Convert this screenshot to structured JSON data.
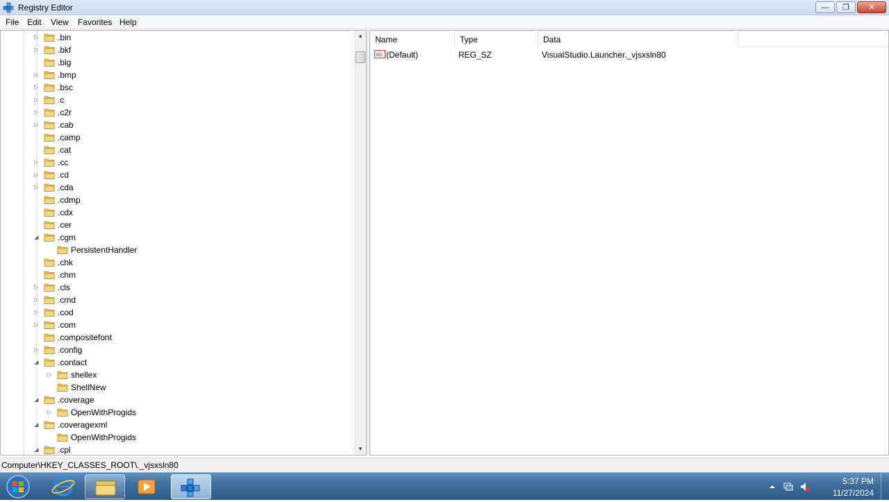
{
  "window": {
    "title": "Registry Editor",
    "minimize_glyph": "—",
    "restore_glyph": "❐",
    "close_glyph": "✕"
  },
  "menu": {
    "items": [
      "File",
      "Edit",
      "View",
      "Favorites",
      "Help"
    ]
  },
  "tree": {
    "nodes": [
      {
        "label": ".bin",
        "level": 0,
        "expander": "collapsed"
      },
      {
        "label": ".bkf",
        "level": 0,
        "expander": "collapsed"
      },
      {
        "label": ".blg",
        "level": 0,
        "expander": "none"
      },
      {
        "label": ".bmp",
        "level": 0,
        "expander": "collapsed"
      },
      {
        "label": ".bsc",
        "level": 0,
        "expander": "collapsed"
      },
      {
        "label": ".c",
        "level": 0,
        "expander": "collapsed"
      },
      {
        "label": ".c2r",
        "level": 0,
        "expander": "collapsed"
      },
      {
        "label": ".cab",
        "level": 0,
        "expander": "collapsed"
      },
      {
        "label": ".camp",
        "level": 0,
        "expander": "none"
      },
      {
        "label": ".cat",
        "level": 0,
        "expander": "none"
      },
      {
        "label": ".cc",
        "level": 0,
        "expander": "collapsed"
      },
      {
        "label": ".cd",
        "level": 0,
        "expander": "collapsed"
      },
      {
        "label": ".cda",
        "level": 0,
        "expander": "collapsed"
      },
      {
        "label": ".cdmp",
        "level": 0,
        "expander": "none"
      },
      {
        "label": ".cdx",
        "level": 0,
        "expander": "none"
      },
      {
        "label": ".cer",
        "level": 0,
        "expander": "none"
      },
      {
        "label": ".cgm",
        "level": 0,
        "expander": "expanded"
      },
      {
        "label": "PersistentHandler",
        "level": 1,
        "expander": "none"
      },
      {
        "label": ".chk",
        "level": 0,
        "expander": "none"
      },
      {
        "label": ".chm",
        "level": 0,
        "expander": "none"
      },
      {
        "label": ".cls",
        "level": 0,
        "expander": "collapsed"
      },
      {
        "label": ".cmd",
        "level": 0,
        "expander": "collapsed"
      },
      {
        "label": ".cod",
        "level": 0,
        "expander": "collapsed"
      },
      {
        "label": ".com",
        "level": 0,
        "expander": "collapsed"
      },
      {
        "label": ".compositefont",
        "level": 0,
        "expander": "none"
      },
      {
        "label": ".config",
        "level": 0,
        "expander": "collapsed"
      },
      {
        "label": ".contact",
        "level": 0,
        "expander": "expanded"
      },
      {
        "label": "shellex",
        "level": 1,
        "expander": "collapsed"
      },
      {
        "label": "ShellNew",
        "level": 1,
        "expander": "none"
      },
      {
        "label": ".coverage",
        "level": 0,
        "expander": "expanded"
      },
      {
        "label": "OpenWithProgids",
        "level": 1,
        "expander": "collapsed"
      },
      {
        "label": ".coveragexml",
        "level": 0,
        "expander": "expanded"
      },
      {
        "label": "OpenWithProgids",
        "level": 1,
        "expander": "none"
      },
      {
        "label": ".cpl",
        "level": 0,
        "expander": "expanded"
      }
    ]
  },
  "values": {
    "columns": [
      "Name",
      "Type",
      "Data"
    ],
    "rows": [
      {
        "icon": "string-value-icon",
        "name": "(Default)",
        "type": "REG_SZ",
        "data": "VisualStudio.Launcher._vjsxsln80"
      }
    ]
  },
  "status": {
    "path": "Computer\\HKEY_CLASSES_ROOT\\._vjsxsln80"
  },
  "taskbar": {
    "apps": [
      "start-orb-icon",
      "internet-explorer-icon",
      "windows-explorer-icon",
      "media-player-icon",
      "registry-editor-icon"
    ],
    "clock_time": "5:37 PM",
    "clock_date": "11/27/2024"
  },
  "colors": {
    "folder": "#e8c45a",
    "taskbar": "#3b6d9e",
    "titlebar": "#cddcef"
  }
}
